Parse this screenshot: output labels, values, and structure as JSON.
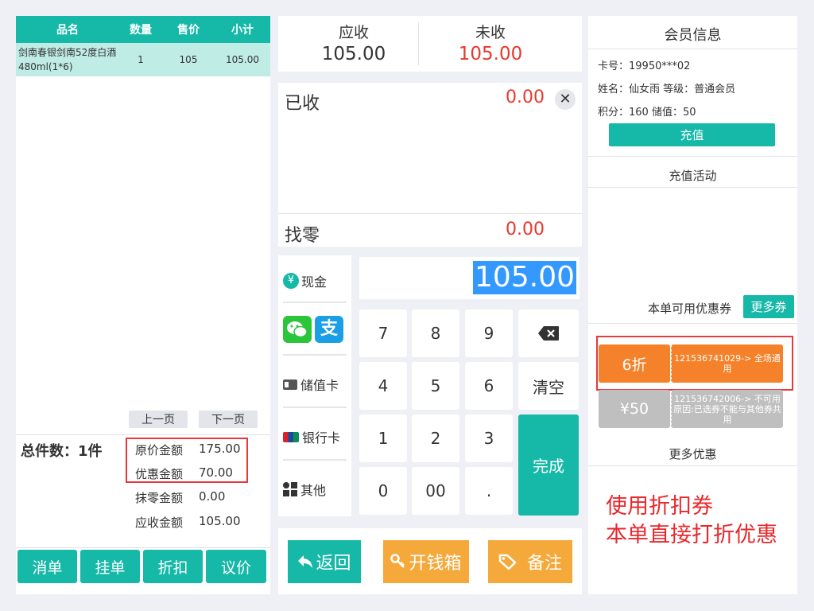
{
  "table": {
    "headers": [
      "品名",
      "数量",
      "售价",
      "小计"
    ],
    "row": {
      "name": "剑南春银剑南52度白酒480ml(1*6)",
      "qty": "1",
      "price": "105",
      "subtotal": "105.00"
    }
  },
  "pager": {
    "prev": "上一页",
    "next": "下一页"
  },
  "totals": {
    "count": "总件数：1件",
    "original_label": "原价金额",
    "original_value": "175.00",
    "discount_label": "优惠金额",
    "discount_value": "70.00",
    "rounding_label": "抹零金额",
    "rounding_value": "0.00",
    "due_label": "应收金额",
    "due_value": "105.00"
  },
  "bottom_buttons": [
    "消单",
    "挂单",
    "折扣",
    "议价"
  ],
  "amounts": {
    "receivable_label": "应收",
    "receivable_value": "105.00",
    "unpaid_label": "未收",
    "unpaid_value": "105.00"
  },
  "received": {
    "label": "已收",
    "value": "0.00",
    "change_label": "找零",
    "change_value": "0.00",
    "clear_icon": "close-icon"
  },
  "payments": {
    "cash": "现金",
    "stored_card": "储值卡",
    "bank_card": "银行卡",
    "other": "其他"
  },
  "display": {
    "value": "105.00"
  },
  "keypad": {
    "k7": "7",
    "k8": "8",
    "k9": "9",
    "k4": "4",
    "k5": "5",
    "k6": "6",
    "k1": "1",
    "k2": "2",
    "k3": "3",
    "k0": "0",
    "k00": "00",
    "kdot": ".",
    "clear": "清空",
    "done": "完成"
  },
  "actions": {
    "back": "返回",
    "cashbox": "开钱箱",
    "note": "备注"
  },
  "member": {
    "title": "会员信息",
    "card": "卡号：19950***02",
    "name_level": "姓名：仙女雨  等级：普通会员",
    "points_balance": "积分：160  储值：50",
    "recharge": "充值",
    "recharge_activity": "充值活动",
    "coupons_label": "本单可用优惠券",
    "more_coupons": "更多券",
    "coupon1_value": "6折",
    "coupon1_desc": "121536741029-> 全场通用",
    "coupon2_value": "¥50",
    "coupon2_desc": "121536742006-> 不可用原因:已选券不能与其他券共用",
    "more_offers": "更多优惠"
  },
  "annotation": {
    "line1": "使用折扣券",
    "line2": "本单直接打折优惠"
  },
  "colors": {
    "teal": "#16b8a8",
    "red": "#e8382c",
    "orange": "#f5822a",
    "gold": "#f5a93a",
    "gray": "#bfbfbf"
  }
}
